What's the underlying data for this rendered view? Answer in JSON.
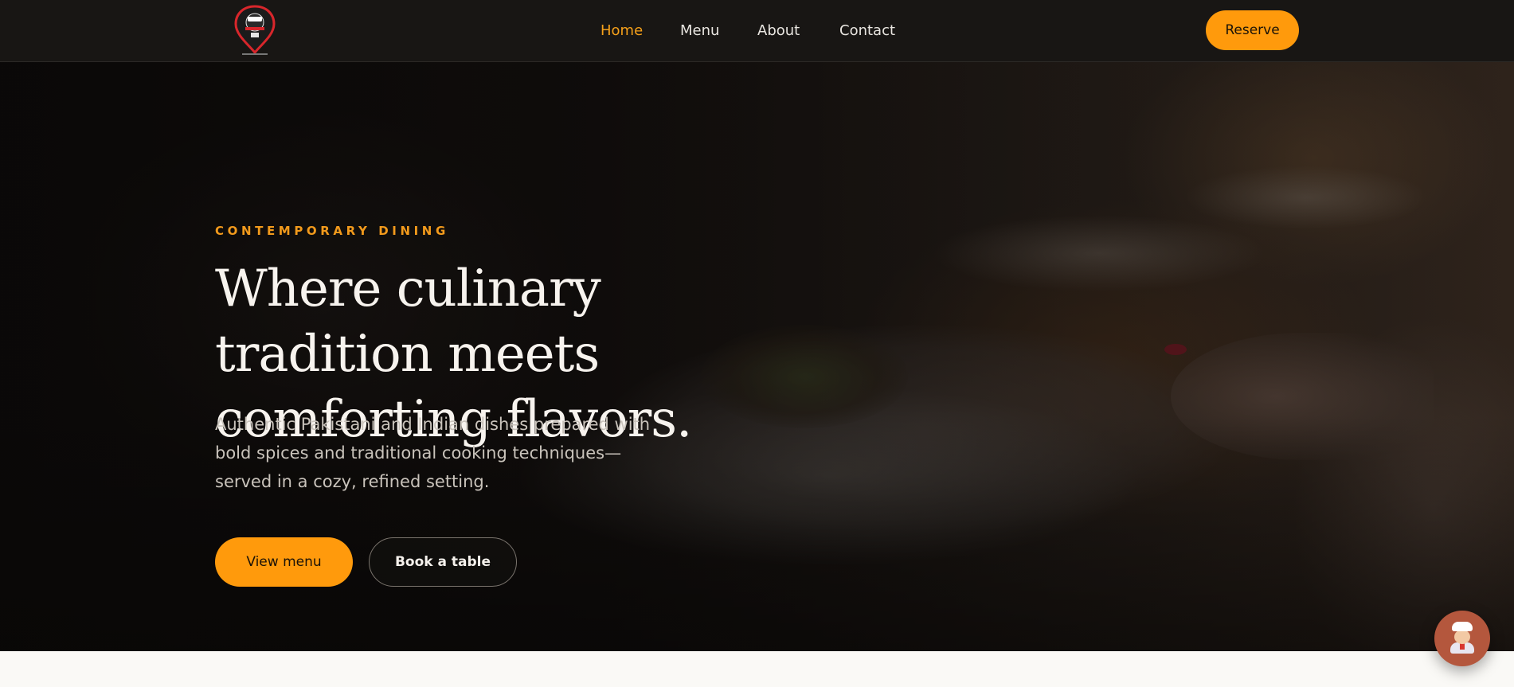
{
  "nav": {
    "links": [
      {
        "label": "Home",
        "active": true
      },
      {
        "label": "Menu",
        "active": false
      },
      {
        "label": "About",
        "active": false
      },
      {
        "label": "Contact",
        "active": false
      }
    ],
    "reserve_label": "Reserve",
    "logo_icon": "restaurant-pin-logo-icon"
  },
  "hero": {
    "eyebrow": "CONTEMPORARY DINING",
    "title": "Where culinary tradition meets comforting flavors.",
    "subtitle": "Authentic Pakistani and Indian dishes prepared with bold spices and traditional cooking techniques—served in a cozy, refined setting.",
    "primary_label": "View menu",
    "secondary_label": "Book a table"
  },
  "chat": {
    "icon": "chef-avatar-icon"
  },
  "colors": {
    "accent": "#ff9a0c",
    "nav_bg": "#181614",
    "active_link": "#f5a01a",
    "page_bg": "#faf9f6"
  }
}
